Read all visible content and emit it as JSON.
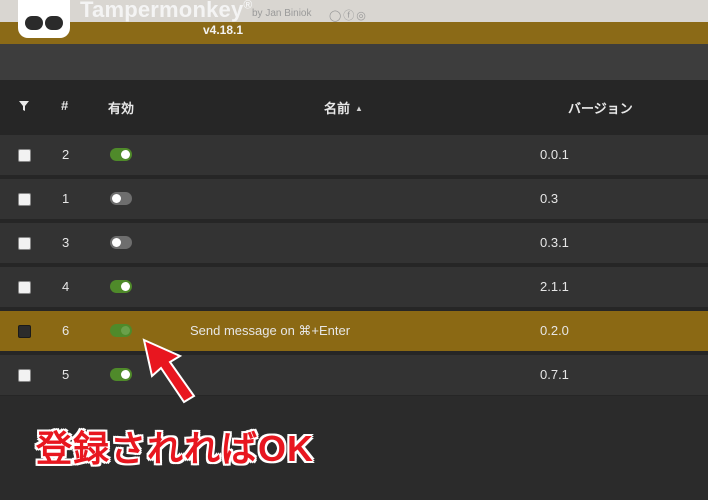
{
  "header": {
    "title": "Tampermonkey",
    "registered_mark": "®",
    "byline": "by Jan Biniok",
    "social_icons": "◯ⓕ◎",
    "version": "v4.18.1"
  },
  "table": {
    "columns": {
      "filter_icon": "filter-icon",
      "number": "#",
      "enabled": "有効",
      "name": "名前",
      "name_sort": "▲",
      "version": "バージョン"
    },
    "rows": [
      {
        "number": "2",
        "enabled": true,
        "name": "",
        "version": "0.0.1",
        "selected": false
      },
      {
        "number": "1",
        "enabled": false,
        "name": "",
        "version": "0.3",
        "selected": false
      },
      {
        "number": "3",
        "enabled": false,
        "name": "",
        "version": "0.3.1",
        "selected": false
      },
      {
        "number": "4",
        "enabled": true,
        "name": "",
        "version": "2.1.1",
        "selected": false
      },
      {
        "number": "6",
        "enabled": true,
        "name": "Send message on ⌘+Enter",
        "version": "0.2.0",
        "selected": true
      },
      {
        "number": "5",
        "enabled": true,
        "name": "",
        "version": "0.7.1",
        "selected": false
      }
    ]
  },
  "annotation": {
    "text": "登録されればOK",
    "color": "#e8161f"
  },
  "colors": {
    "brand_band": "#8b6a17",
    "selected_row": "#8b6914",
    "toggle_on": "#4f8a2a",
    "toggle_off": "#6e6e6e"
  }
}
